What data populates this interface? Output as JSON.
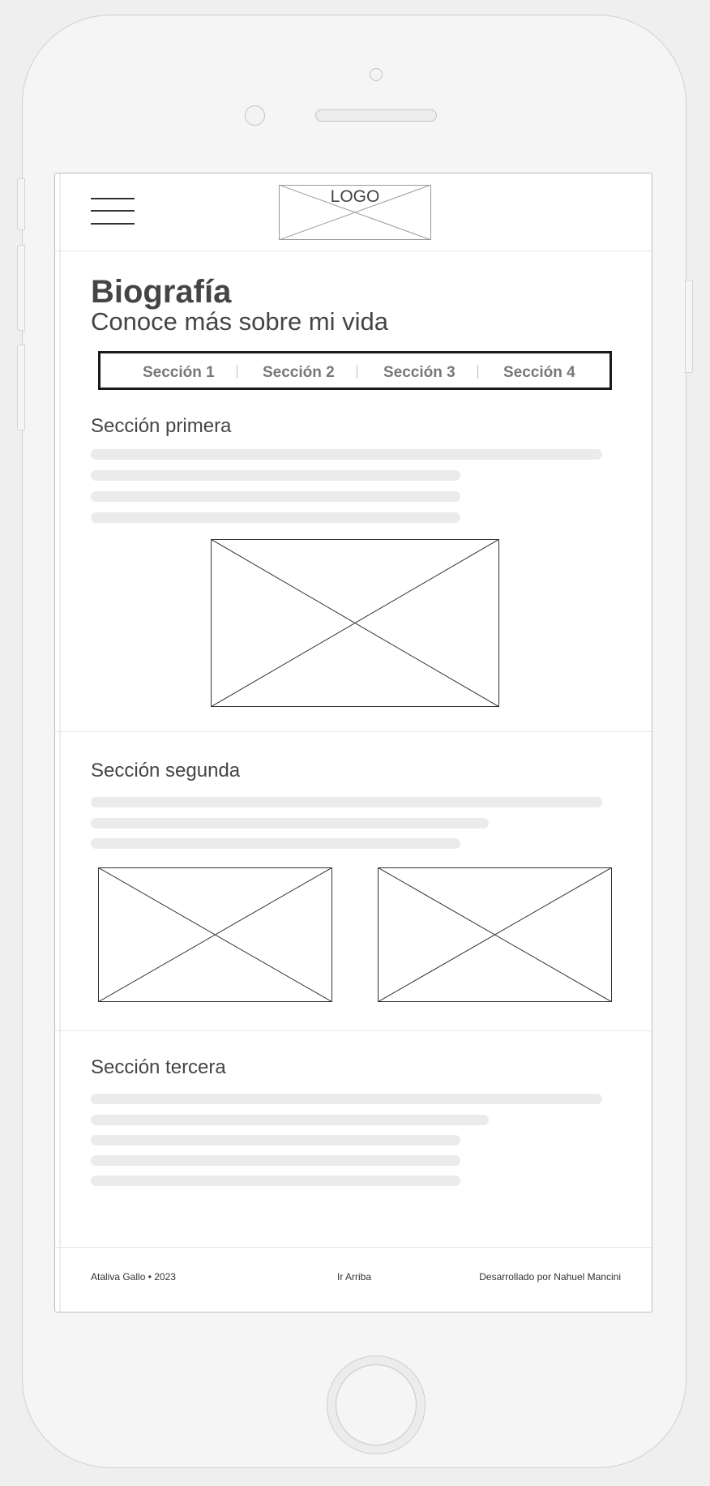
{
  "header": {
    "logo_label": "LOGO"
  },
  "page": {
    "title": "Biografía",
    "subtitle": "Conoce más sobre mi vida"
  },
  "tabs": [
    {
      "label": "Sección 1"
    },
    {
      "label": "Sección 2"
    },
    {
      "label": "Sección 3"
    },
    {
      "label": "Sección 4"
    }
  ],
  "sections": [
    {
      "title": "Sección primera"
    },
    {
      "title": "Sección segunda"
    },
    {
      "title": "Sección tercera"
    }
  ],
  "footer": {
    "copyright": "Ataliva Gallo • 2023",
    "back_to_top": "Ir Arriba",
    "credits": "Desarrollado por Nahuel Mancini"
  },
  "icons": {
    "menu": "hamburger-menu-icon",
    "image_placeholder": "image-placeholder-icon"
  }
}
